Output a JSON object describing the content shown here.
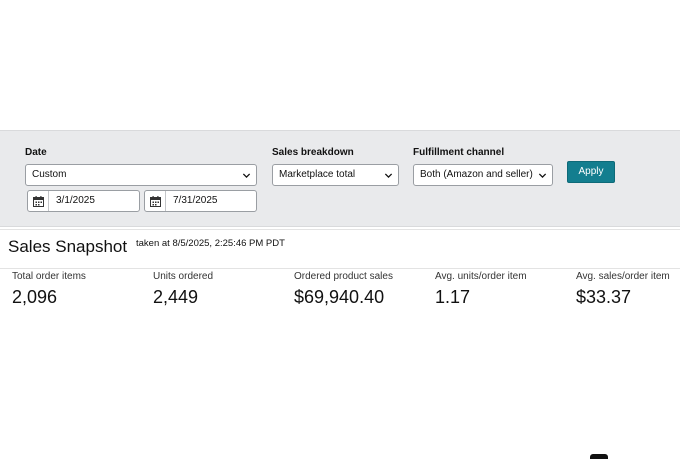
{
  "filters": {
    "date": {
      "label": "Date",
      "selected": "Custom",
      "start_date": "3/1/2025",
      "end_date": "7/31/2025"
    },
    "sales_breakdown": {
      "label": "Sales breakdown",
      "selected": "Marketplace total"
    },
    "fulfillment_channel": {
      "label": "Fulfillment channel",
      "selected": "Both (Amazon and seller)"
    },
    "apply_label": "Apply"
  },
  "snapshot": {
    "title": "Sales Snapshot",
    "taken_at": "taken at 8/5/2025, 2:25:46 PM PDT",
    "metrics": [
      {
        "label": "Total order items",
        "value": "2,096"
      },
      {
        "label": "Units ordered",
        "value": "2,449"
      },
      {
        "label": "Ordered product sales",
        "value": "$69,940.40"
      },
      {
        "label": "Avg. units/order item",
        "value": "1.17"
      },
      {
        "label": "Avg. sales/order item",
        "value": "$33.37"
      }
    ]
  },
  "colors": {
    "accent": "#137e8f",
    "panel_bg": "#e9eaec"
  },
  "icons": {
    "calendar": "calendar-icon",
    "dropdown": "chevron-down-icon"
  }
}
